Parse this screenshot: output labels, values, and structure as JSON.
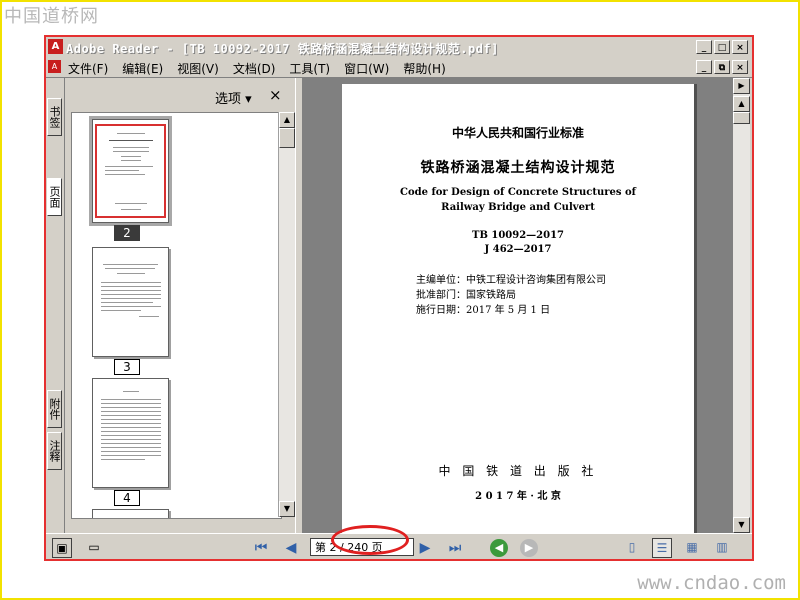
{
  "watermark_top": "中国道桥网",
  "watermark_bottom": "www.cndao.com",
  "window": {
    "title": "Adobe Reader - [TB 10092-2017 铁路桥涵混凝土结构设计规范.pdf]",
    "minimize": "_",
    "maximize": "□",
    "close": "×",
    "restore": "⧉"
  },
  "menu": [
    "文件(F)",
    "编辑(E)",
    "视图(V)",
    "文档(D)",
    "工具(T)",
    "窗口(W)",
    "帮助(H)"
  ],
  "side_tabs": [
    "书签",
    "页面",
    "附件",
    "注释"
  ],
  "panel": {
    "options_label": "选项 ▾",
    "close_label": "×",
    "thumbnails": [
      "2",
      "3",
      "4"
    ]
  },
  "document": {
    "standard_header": "中华人民共和国行业标准",
    "title_cn": "铁路桥涵混凝土结构设计规范",
    "title_en_1": "Code for Design of Concrete Structures of",
    "title_en_2": "Railway Bridge and Culvert",
    "code_1": "TB 10092—2017",
    "code_2": "J 462—2017",
    "editor": "主编单位：中铁工程设计咨询集团有限公司",
    "approver": "批准部门：国家铁路局",
    "effective": "施行日期：2017 年 5 月 1 日",
    "publisher": "中 国 铁 道 出 版 社",
    "pub_date": "2 0 1 7 年 · 北  京"
  },
  "bottom": {
    "page_display": "第 2 / 240 页"
  },
  "colors": {
    "annotation_red": "#e02020",
    "frame_yellow": "#f2e200",
    "window_gray": "#d4d0c8"
  }
}
